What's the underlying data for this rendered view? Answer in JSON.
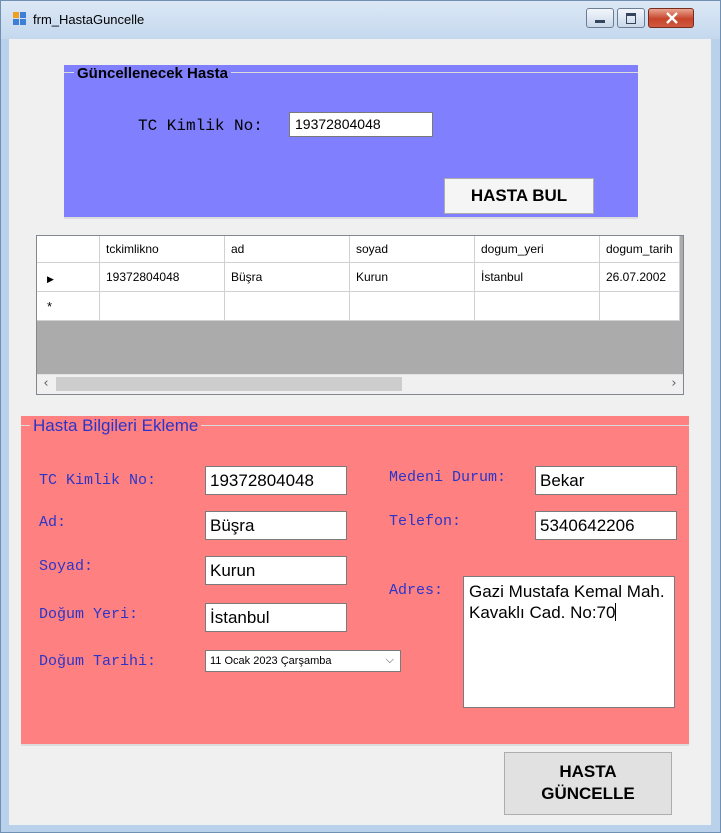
{
  "window": {
    "title": "frm_HastaGuncelle"
  },
  "search_group": {
    "legend": "Güncellenecek Hasta",
    "tc_label": "TC Kimlik No:",
    "tc_value": "19372804048",
    "find_button": "HASTA BUL"
  },
  "grid": {
    "columns": [
      "tckimlikno",
      "ad",
      "soyad",
      "dogum_yeri",
      "dogum_tarih"
    ],
    "rows": [
      {
        "marker": "▶",
        "cells": [
          "19372804048",
          "Büşra",
          "Kurun",
          "İstanbul",
          "26.07.2002"
        ]
      },
      {
        "marker": "*",
        "cells": [
          "",
          "",
          "",
          "",
          ""
        ]
      }
    ]
  },
  "details_group": {
    "legend": "Hasta Bilgileri Ekleme",
    "tc_label": "TC Kimlik No:",
    "tc_value": "19372804048",
    "ad_label": "Ad:",
    "ad_value": "Büşra",
    "soyad_label": "Soyad:",
    "soyad_value": "Kurun",
    "dogum_yeri_label": "Doğum Yeri:",
    "dogum_yeri_value": "İstanbul",
    "dogum_tarihi_label": "Doğum Tarihi:",
    "dogum_tarihi_value": "11 Ocak 2023 Çarşamba",
    "medeni_label": "Medeni Durum:",
    "medeni_value": "Bekar",
    "telefon_label": "Telefon:",
    "telefon_value": "5340642206",
    "adres_label": "Adres:",
    "adres_value": "Gazi Mustafa Kemal Mah. Kavaklı Cad. No:70"
  },
  "update_button": {
    "line1": "HASTA",
    "line2": "GÜNCELLE"
  }
}
